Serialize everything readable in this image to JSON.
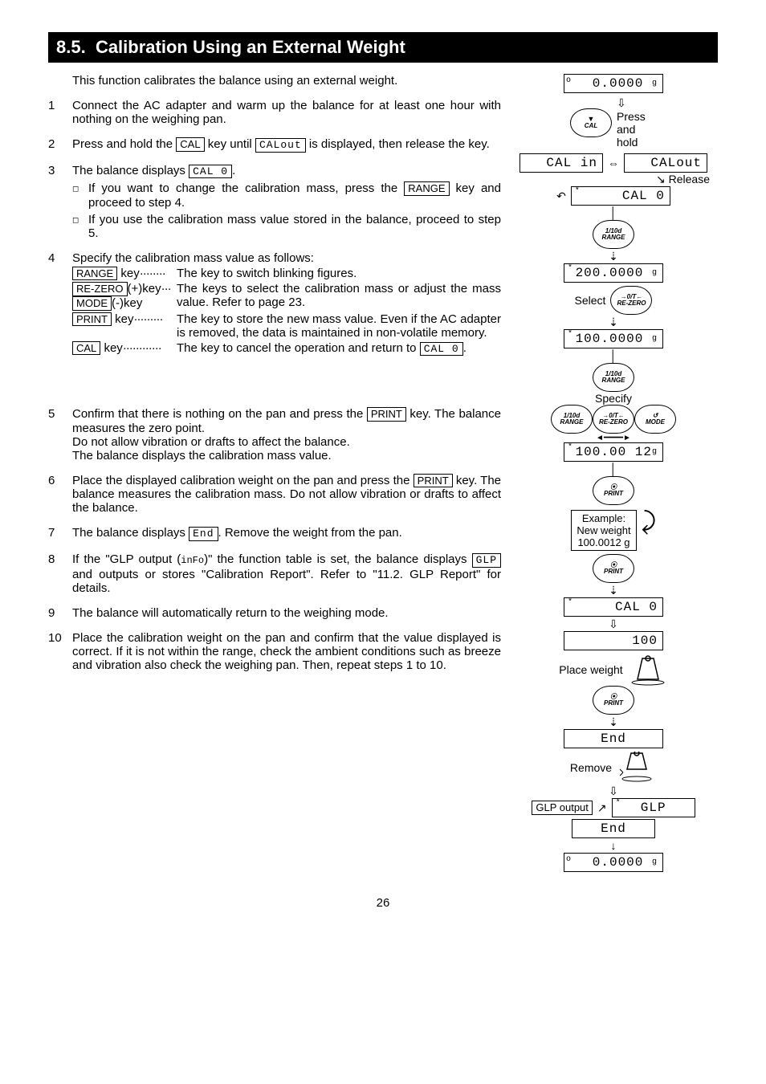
{
  "section_number": "8.5.",
  "section_title": "Calibration Using an External Weight",
  "intro": "This function calibrates the balance using an external weight.",
  "steps": [
    {
      "num": "1",
      "text1": "Connect the AC adapter and warm up the balance for at least one hour with nothing on the weighing pan."
    },
    {
      "num": "2",
      "text1": "Press and hold the ",
      "key1": "CAL",
      "text2": " key until ",
      "seg1": "CALout",
      "text3": " is displayed, then release the key."
    },
    {
      "num": "3",
      "text1": "The balance displays ",
      "seg1": "CAL  0",
      "text2": ".",
      "bullets": [
        {
          "t1": "If you want to change the calibration mass, press the ",
          "key": "RANGE",
          "t2": " key and proceed to step 4."
        },
        {
          "t1": "If you use the calibration mass value stored in the balance, proceed to step 5."
        }
      ]
    },
    {
      "num": "4",
      "text1": "Specify the calibration mass value as follows:",
      "keyrows": [
        {
          "klabel_key": "RANGE",
          "klabel_suffix": " key",
          "dots": "········",
          "desc": "The key to switch blinking figures."
        },
        {
          "klabel_key": "RE-ZERO",
          "klabel_suffix": "(+)key",
          "klabel_key2": "MODE",
          "klabel_suffix2": "(-)key",
          "dots": "···",
          "desc": "The keys to select the calibration mass or adjust the mass value. Refer to page 23."
        },
        {
          "klabel_key": "PRINT",
          "klabel_suffix": " key",
          "dots": "·········",
          "desc": "The key to store the new mass value. Even if the AC adapter is removed, the data is maintained in non-volatile memory."
        },
        {
          "klabel_key": "CAL",
          "klabel_suffix": " key",
          "dots": "············",
          "desc_pre": "The key to cancel the operation and return to ",
          "desc_seg": "CAL 0",
          "desc_post": "."
        }
      ]
    },
    {
      "num": "5",
      "text1": "Confirm that there is nothing on the pan and press the ",
      "key1": "PRINT",
      "text2": " key. The balance measures the zero point.",
      "text3": "Do not allow vibration or drafts to affect the balance.",
      "text4": "The balance displays the calibration mass value."
    },
    {
      "num": "6",
      "text1": "Place the displayed calibration weight on the pan and press the ",
      "key1": "PRINT",
      "text2": " key. The balance measures the calibration mass. Do not allow vibration or drafts to affect the balance."
    },
    {
      "num": "7",
      "text1": "The balance displays ",
      "seg1": "End",
      "text2": ". Remove the weight from the pan."
    },
    {
      "num": "8",
      "text1": "If the \"GLP output (",
      "small1": "inFo",
      "text2": ")\" the function table is set, the balance displays ",
      "seg1": "GLP",
      "text3": " and outputs or stores \"Calibration Report\". Refer to \"11.2. GLP Report\" for details."
    },
    {
      "num": "9",
      "text1": "The balance will automatically return to the weighing mode."
    },
    {
      "num": "10",
      "text1": "Place the calibration weight on the pan and confirm that the value displayed is correct. If it is not within the range, check the ambient conditions such as breeze and vibration also check the weighing pan. Then, repeat steps 1 to 10."
    }
  ],
  "flow": {
    "lcd_start": "0.0000",
    "unit_g": "g",
    "btn_cal_tri": "▼",
    "btn_cal": "CAL",
    "press_hold": "Press and hold",
    "lcd_calin": "CAL  in",
    "lcd_calout": "CALout",
    "release": "Release",
    "lcd_cal0": "CAL   0",
    "btn_range_top": "1/10d",
    "btn_range": "RANGE",
    "lcd_200": "200.0000",
    "select": "Select",
    "btn_rezero_top": "→0/T←",
    "btn_rezero": "RE-ZERO",
    "lcd_100": "100.0000",
    "specify": "Specify",
    "btn_mode_top": "↺",
    "btn_mode": "MODE",
    "lcd_100_12": "100.00 12",
    "btn_print_top": "⦿",
    "btn_print": "PRINT",
    "example_l1": "Example:",
    "example_l2": "New weight",
    "example_l3": "100.0012 g",
    "lcd_cal0_b": "CAL   0",
    "lcd_100b": "100",
    "place_weight": "Place weight",
    "lcd_end": "End",
    "remove": "Remove",
    "lcd_glp": "GLP",
    "glp_output": "GLP output",
    "lcd_end2": "End",
    "lcd_final": "0.0000"
  },
  "page_number": "26"
}
